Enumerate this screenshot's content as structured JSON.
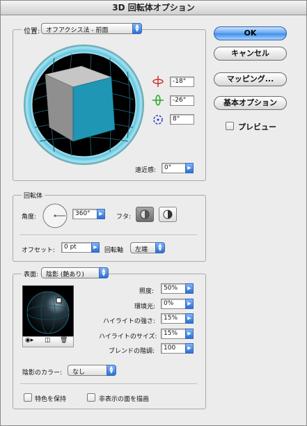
{
  "window": {
    "title": "3D 回転体オプション"
  },
  "position": {
    "group_label": "位置:",
    "preset": "オフアクシス法 - 前面",
    "rot_x": "-18°",
    "rot_y": "-26°",
    "rot_z": "8°",
    "perspective_label": "遠近感:",
    "perspective": "0°"
  },
  "buttons": {
    "ok": "OK",
    "cancel": "キャンセル",
    "mapping": "マッピング...",
    "basic_options": "基本オプション"
  },
  "preview": {
    "label": "プレビュー",
    "checked": false
  },
  "revolve": {
    "group_label": "回転体",
    "angle_label": "角度:",
    "angle": "360°",
    "cap_label": "フタ:",
    "offset_label": "オフセット:",
    "offset": "0 pt",
    "axis_label": "回転軸",
    "axis": "左端"
  },
  "surface": {
    "label": "表面:",
    "value": "陰影 (艶あり)",
    "light_intensity_label": "照度:",
    "light_intensity": "50%",
    "ambient_label": "環境光:",
    "ambient": "0%",
    "highlight_intensity_label": "ハイライトの強さ:",
    "highlight_intensity": "15%",
    "highlight_size_label": "ハイライトのサイズ:",
    "highlight_size": "15%",
    "blend_steps_label": "ブレンドの階調:",
    "blend_steps": "100",
    "shading_color_label": "陰影のカラー:",
    "shading_color": "なし",
    "preserve_spot_label": "特色を保持",
    "draw_hidden_label": "非表示の面を描画"
  },
  "colors": {
    "cube_front": "#1f96b4",
    "cube_side": "#8f8f8f",
    "cube_top": "#c6c6c6",
    "accent": "#3d8cea"
  }
}
